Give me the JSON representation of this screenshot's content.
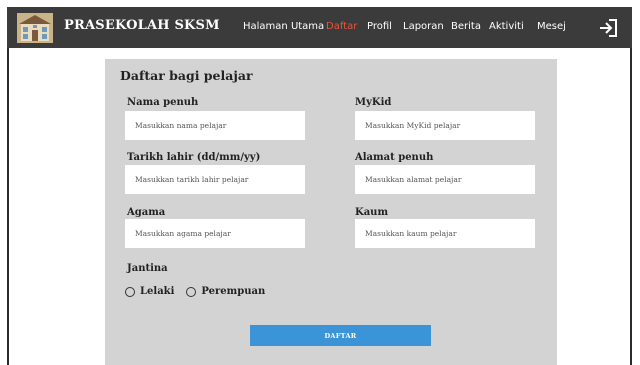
{
  "app": {
    "brand": "PRASEKOLAH SKSM"
  },
  "nav": {
    "items": [
      "Halaman Utama",
      "Daftar",
      "Profil",
      "Laporan",
      "Berita",
      "Aktiviti",
      "Mesej"
    ],
    "active": "Daftar",
    "active_color": "#e8543a"
  },
  "form": {
    "title": "Daftar bagi pelajar",
    "fields": {
      "name": {
        "label": "Nama penuh",
        "placeholder": "Masukkan nama pelajar"
      },
      "mykid": {
        "label": "MyKid",
        "placeholder": "Masukkan MyKid pelajar"
      },
      "dob": {
        "label": "Tarikh lahir (dd/mm/yy)",
        "placeholder": "Masukkan tarikh lahir pelajar"
      },
      "address": {
        "label": "Alamat penuh",
        "placeholder": "Masukkan alamat pelajar"
      },
      "religion": {
        "label": "Agama",
        "placeholder": "Masukkan agama pelajar"
      },
      "race": {
        "label": "Kaum",
        "placeholder": "Masukkan kaum pelajar"
      }
    },
    "gender": {
      "label": "Jantina",
      "options": [
        "Lelaki",
        "Perempuan"
      ]
    },
    "submit_label": "DAFTAR"
  },
  "icons": {
    "logo": "school-building-icon",
    "logout": "logout-icon"
  },
  "colors": {
    "navbar": "#3b3b3b",
    "panel": "#d3d3d3",
    "button": "#3b93d8"
  }
}
